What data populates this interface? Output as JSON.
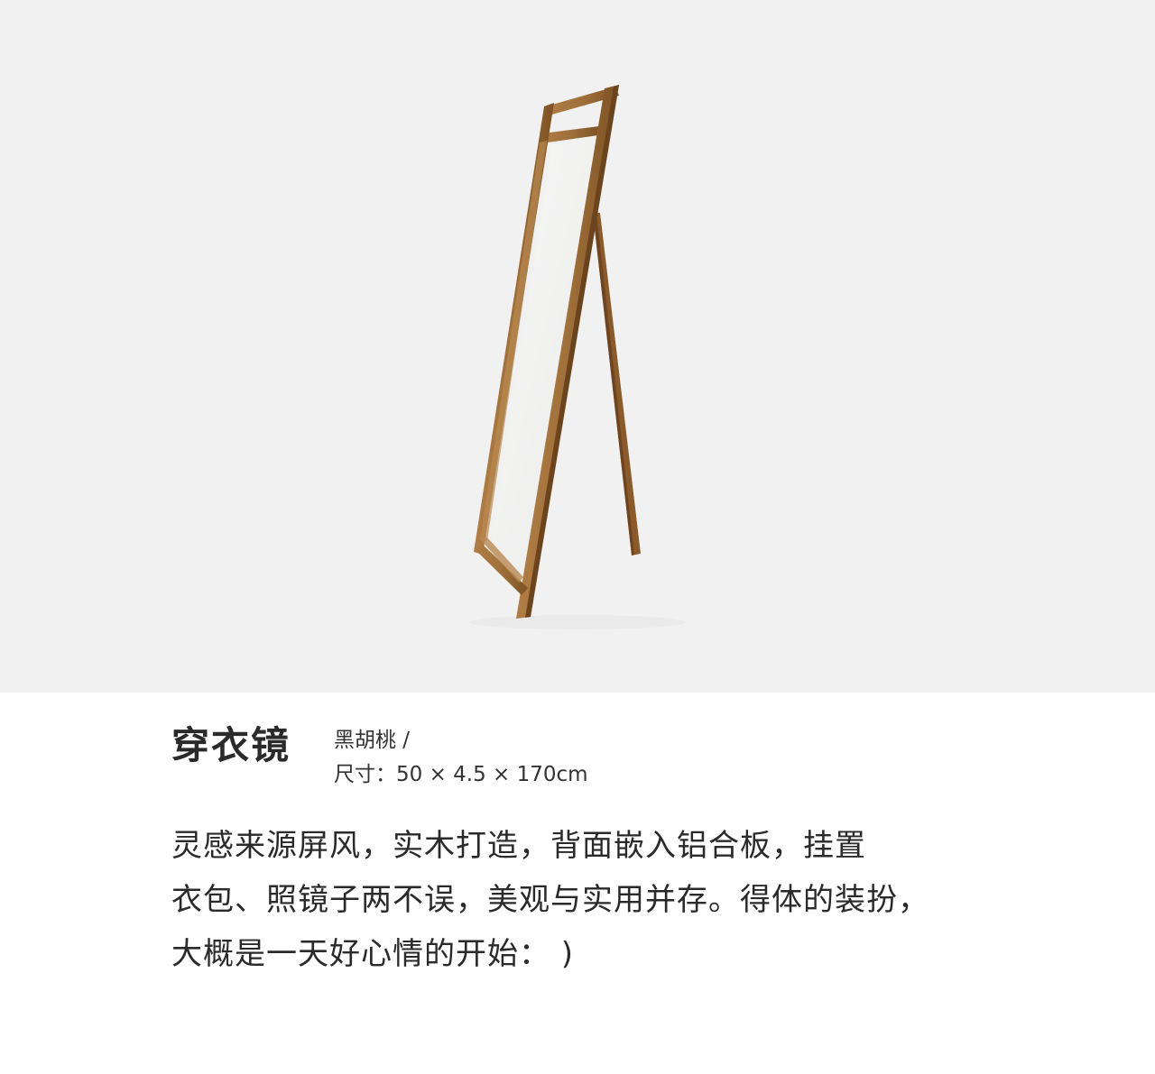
{
  "image": {
    "subject": "floor-mirror-photo",
    "icon": "mirror-icon",
    "colors": {
      "background": "#f1f1f1",
      "wood": "#a0703a",
      "wood_dark": "#7d5224",
      "mirror": "#f4f4f3"
    }
  },
  "product": {
    "title": "穿衣镜",
    "material": "黑胡桃 /",
    "size": "尺寸：50 × 4.5 × 170cm"
  },
  "description": {
    "lines": [
      "灵感来源屏风，实木打造，背面嵌入铝合板，挂置",
      "衣包、照镜子两不误，美观与实用并存。得体的装扮，",
      "大概是一天好心情的开始： )"
    ]
  }
}
